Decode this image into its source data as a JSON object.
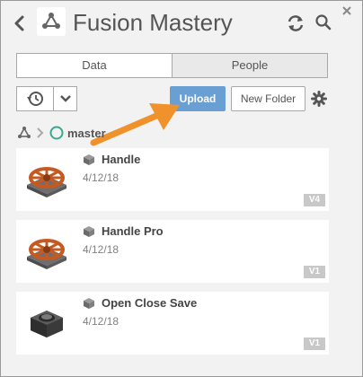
{
  "header": {
    "title": "Fusion Mastery",
    "icons": {
      "back": "chevron-left-icon",
      "project": "fusion-hub-icon",
      "refresh": "refresh-icon",
      "search": "search-icon",
      "close": "close-icon"
    }
  },
  "tabs": [
    {
      "label": "Data",
      "active": true
    },
    {
      "label": "People",
      "active": false
    }
  ],
  "toolbar": {
    "upload_label": "Upload",
    "new_folder_label": "New Folder",
    "icons": {
      "history": "history-icon",
      "dropdown": "chevron-down-icon",
      "settings": "gear-icon"
    }
  },
  "breadcrumb": {
    "items": [
      {
        "label": "",
        "icon": "fusion-hub-icon"
      },
      {
        "label": "master",
        "icon": "folder-circle-icon"
      }
    ]
  },
  "files": [
    {
      "name": "Handle",
      "date": "4/12/18",
      "version": "V4",
      "thumbnail": "valve-handle-red"
    },
    {
      "name": "Handle Pro",
      "date": "4/12/18",
      "version": "V1",
      "thumbnail": "valve-handle-red"
    },
    {
      "name": "Open Close Save",
      "date": "4/12/18",
      "version": "V1",
      "thumbnail": "hex-nut-dark"
    }
  ],
  "colors": {
    "accent": "#6a9fd4",
    "annotation_arrow": "#f0922b",
    "breadcrumb_circle": "#3aa88e",
    "panel_bg": "#f2f2f2"
  }
}
